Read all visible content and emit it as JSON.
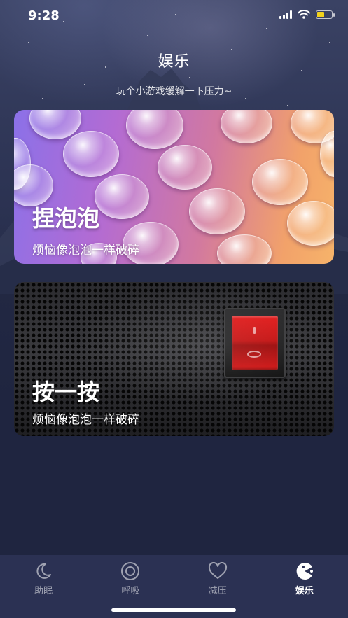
{
  "status_bar": {
    "time": "9:28"
  },
  "header": {
    "title": "娱乐",
    "subtitle": "玩个小游戏缓解一下压力~"
  },
  "cards": [
    {
      "title": "捏泡泡",
      "description": "烦恼像泡泡一样破碎"
    },
    {
      "title": "按一按",
      "description": "烦恼像泡泡一样破碎"
    }
  ],
  "tab_bar": {
    "items": [
      {
        "label": "助眠",
        "icon": "moon-icon",
        "active": false
      },
      {
        "label": "呼吸",
        "icon": "breath-circle-icon",
        "active": false
      },
      {
        "label": "减压",
        "icon": "heart-icon",
        "active": false
      },
      {
        "label": "娱乐",
        "icon": "pacman-icon",
        "active": true
      }
    ]
  },
  "colors": {
    "background": "#1f2540",
    "tab_bar": "#2b3153",
    "battery": "#f2d21b",
    "switch_red": "#d31414"
  }
}
